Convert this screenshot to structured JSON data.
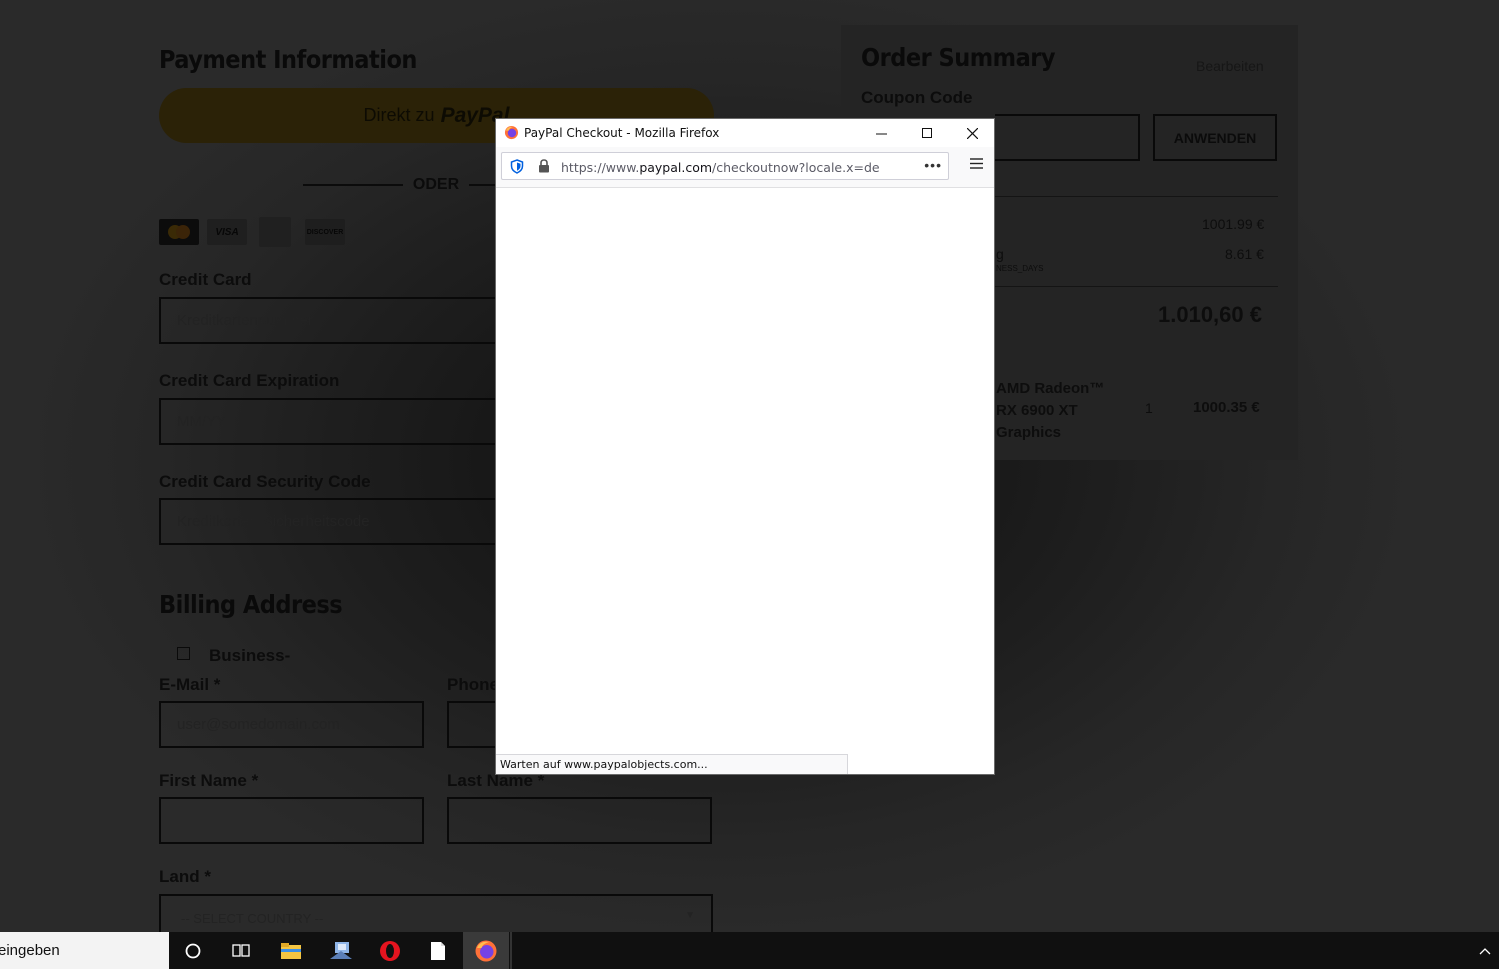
{
  "payment": {
    "title": "Payment Information",
    "paypal_prefix": "Direkt zu",
    "paypal_brand": "PayPal",
    "divider": "ODER",
    "cards": [
      "VISA",
      "DISCOVER"
    ],
    "credit_card_label": "Credit Card",
    "credit_card_placeholder": "Kreditkartennummer",
    "expiration_label": "Credit Card Expiration",
    "expiration_placeholder": "MM/YY",
    "security_label": "Credit Card Security Code",
    "security_placeholder": "Kreditkarten-Sicherheitscode"
  },
  "billing": {
    "title": "Billing Address",
    "business_label": "Business-",
    "email_label": "E-Mail",
    "email_placeholder": "user@somedomain.com",
    "phone_label": "Phone",
    "first_name_label": "First Name",
    "last_name_label": "Last Name",
    "land_label": "Land",
    "country_select": "-- SELECT COUNTRY --",
    "required": "*"
  },
  "summary": {
    "title": "Order Summary",
    "edit_link": "Bearbeiten",
    "coupon_label": "Coupon Code",
    "apply_button": "ANWENDEN",
    "subtotal": "1001.99 €",
    "shipping_partial": "g",
    "shipping_note": "NESS_DAYS",
    "shipping": "8.61 €",
    "total": "1.010,60 €",
    "item_name_line1": "AMD Radeon™",
    "item_name_line2": "RX 6900 XT",
    "item_name_line3": "Graphics",
    "item_qty": "1",
    "item_price": "1000.35 €"
  },
  "popup": {
    "title": "PayPal Checkout - Mozilla Firefox",
    "url_prefix": "https://www.",
    "url_domain": "paypal.com",
    "url_rest": "/checkoutnow?locale.x=de_DE&fun",
    "status": "Warten auf www.paypalobjects.com..."
  },
  "taskbar": {
    "search_text": "eingeben"
  }
}
